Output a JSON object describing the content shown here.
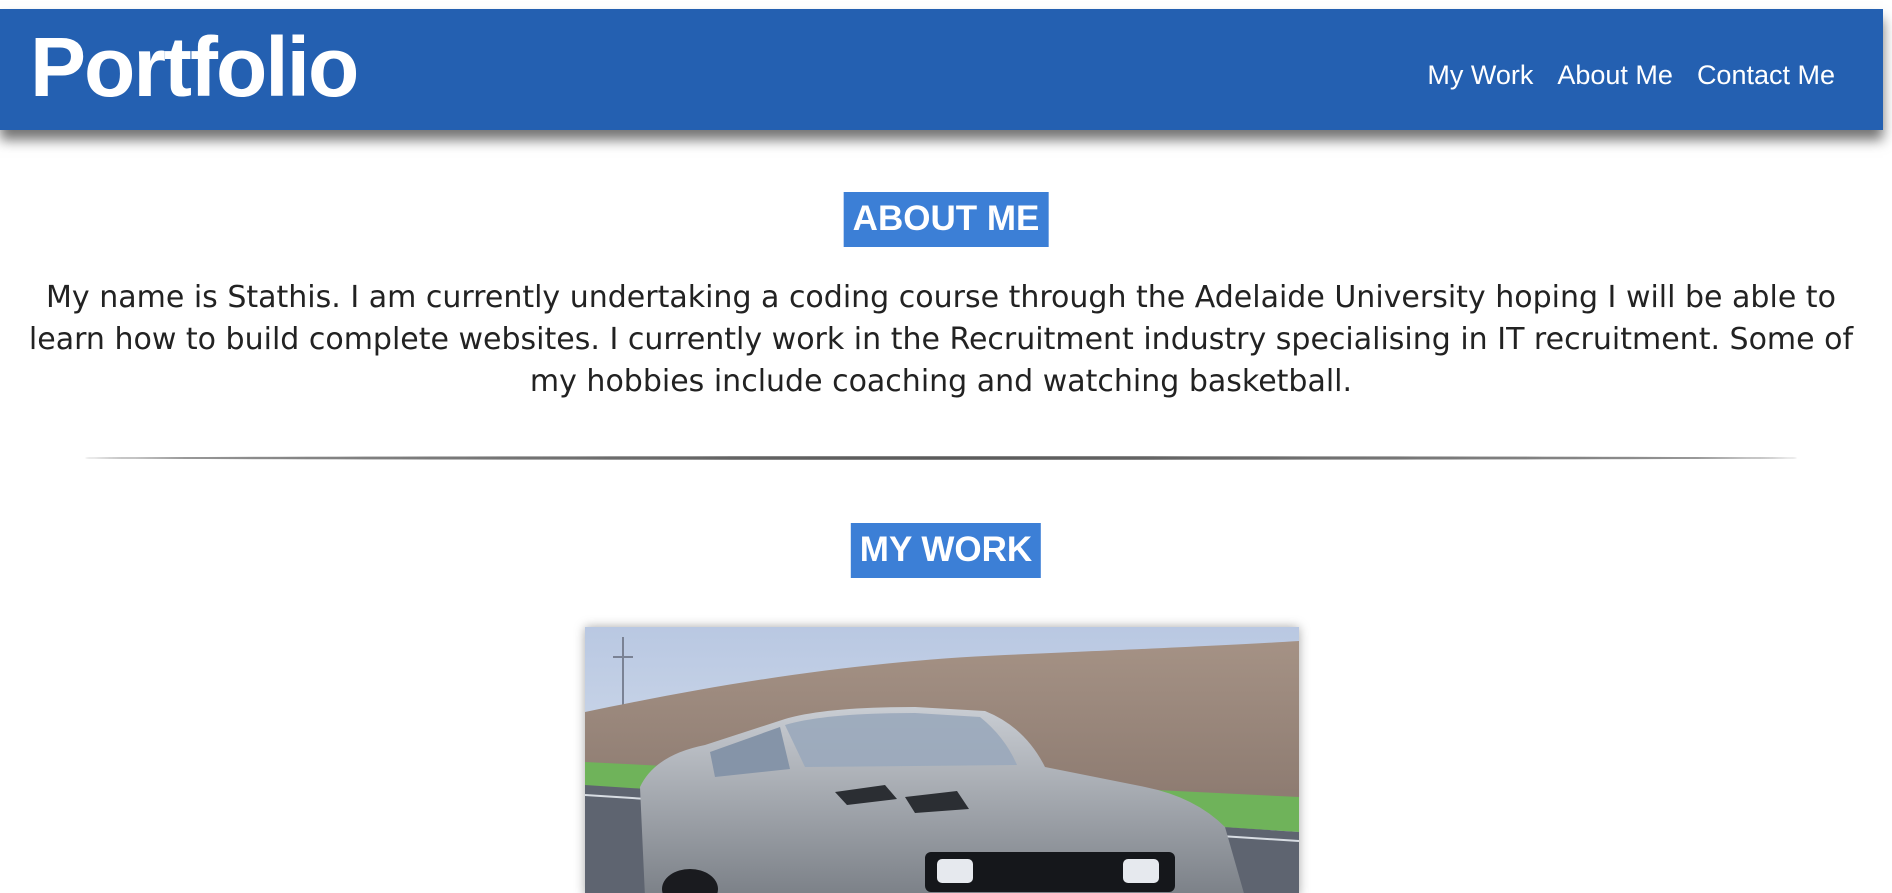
{
  "header": {
    "brand": "Portfolio",
    "nav": [
      {
        "label": "My Work"
      },
      {
        "label": "About Me"
      },
      {
        "label": "Contact Me"
      }
    ]
  },
  "about": {
    "title": "ABOUT ME",
    "text": "My name is Stathis. I am currently undertaking a coding course through the Adelaide University hoping I will be able to learn how to build complete websites. I currently work in the Recruitment industry specialising in IT recruitment. Some of my hobbies include coaching and watching basketball."
  },
  "work": {
    "title": "MY WORK"
  },
  "colors": {
    "header_bg": "#2460b1",
    "title_bg": "#3c7fd6",
    "text": "#222222"
  }
}
